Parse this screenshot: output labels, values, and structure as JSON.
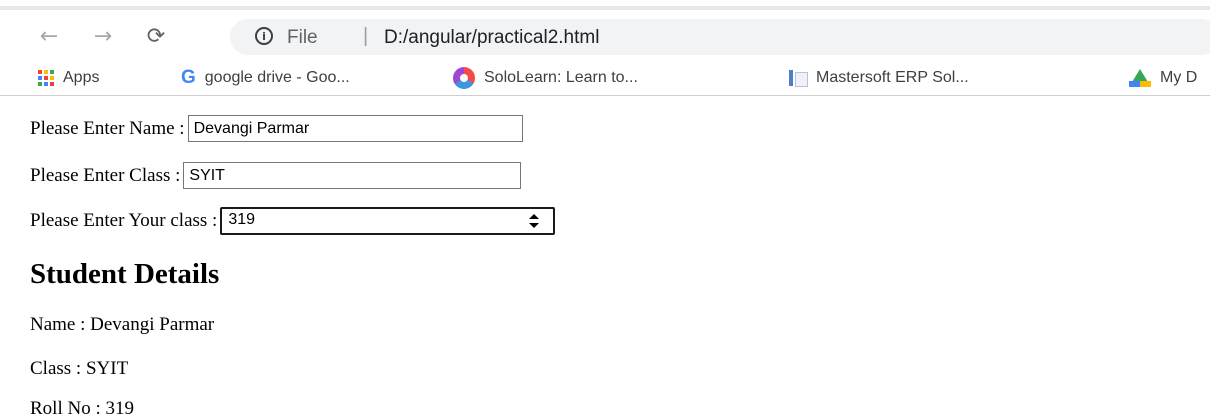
{
  "browser": {
    "address_scheme": "File",
    "address_separator": "|",
    "address_url": "D:/angular/practical2.html",
    "bookmarks": [
      {
        "label": "Apps",
        "icon": "apps-grid-icon"
      },
      {
        "label": "google drive - Goo...",
        "icon": "google-icon"
      },
      {
        "label": "SoloLearn: Learn to...",
        "icon": "sololearn-icon"
      },
      {
        "label": "Mastersoft ERP Sol...",
        "icon": "document-icon"
      },
      {
        "label": "My D",
        "icon": "google-drive-icon"
      }
    ]
  },
  "form": {
    "name_label": "Please Enter Name :",
    "name_value": "Devangi Parmar",
    "class_label": "Please Enter Class :",
    "class_value": "SYIT",
    "roll_label": "Please Enter Your class :",
    "roll_value": "319"
  },
  "details": {
    "heading": "Student Details",
    "name_line": "Name : Devangi Parmar",
    "class_line": "Class : SYIT",
    "roll_line": "Roll No : 319"
  },
  "colors": {
    "apps_grid": [
      "#ea4335",
      "#fbbc04",
      "#34a853",
      "#4285f4",
      "#ea4335",
      "#fbbc04",
      "#34a853",
      "#4285f4",
      "#ea4335"
    ]
  }
}
